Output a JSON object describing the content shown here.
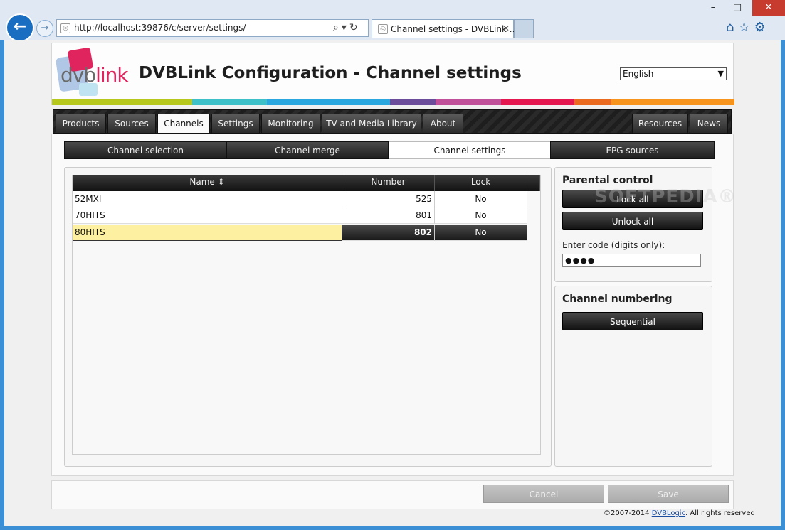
{
  "browser": {
    "url": "http://localhost:39876/c/server/settings/",
    "tab_title": "Channel settings - DVBLink ...",
    "window_buttons": {
      "minimize": "–",
      "maximize": "□",
      "close": "✕"
    },
    "icons": [
      "home-icon",
      "star-icon",
      "gear-icon"
    ]
  },
  "header": {
    "logo": {
      "part1": "dvb",
      "part2": "link"
    },
    "title": "DVBLink Configuration - Channel settings",
    "language": "English",
    "strip_colors": [
      "#b5c81b",
      "#3dc0c7",
      "#2ba7e0",
      "#6b4c9a",
      "#c0509a",
      "#e5174f",
      "#ea6a1f",
      "#f7941d"
    ]
  },
  "nav": {
    "left_tabs": [
      "Products",
      "Sources",
      "Channels",
      "Settings",
      "Monitoring",
      "TV and Media Library",
      "About"
    ],
    "right_tabs": [
      "Resources",
      "News"
    ],
    "active": "Channels"
  },
  "subtabs": {
    "items": [
      "Channel selection",
      "Channel merge",
      "Channel settings",
      "EPG sources"
    ],
    "active": "Channel settings"
  },
  "table": {
    "columns": [
      "Name ⇕",
      "Number",
      "Lock"
    ],
    "rows": [
      {
        "name": "52MXI",
        "number": "525",
        "lock": "No"
      },
      {
        "name": "70HITS",
        "number": "801",
        "lock": "No"
      },
      {
        "name": "80HITS",
        "number": "802",
        "lock": "No"
      }
    ],
    "selected_row": "80HITS"
  },
  "parental": {
    "title": "Parental control",
    "lock_all": "Lock all",
    "unlock_all": "Unlock all",
    "code_label": "Enter code (digits only):",
    "code_value": "●●●●"
  },
  "numbering": {
    "title": "Channel numbering",
    "sequential": "Sequential"
  },
  "watermark": "SOFTPEDIA®",
  "footer": {
    "cancel": "Cancel",
    "save": "Save",
    "copyright_prefix": "©2007-2014",
    "copyright_link": "DVBLogic",
    "copyright_suffix": ". All rights reserved"
  }
}
